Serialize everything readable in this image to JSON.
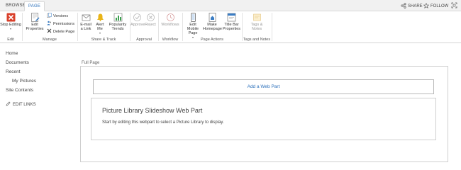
{
  "tabs": {
    "browse": "BROWSE",
    "page": "PAGE"
  },
  "top_actions": {
    "share": "SHARE",
    "follow": "FOLLOW"
  },
  "ribbon": {
    "edit_group": {
      "label": "Edit",
      "stop_editing": "Stop Editing"
    },
    "manage_group": {
      "label": "Manage",
      "edit_properties": "Edit Properties",
      "versions": "Versions",
      "permissions": "Permissions",
      "delete_page": "Delete Page"
    },
    "share_track_group": {
      "label": "Share & Track",
      "email_link": "E-mail a Link",
      "alert_me": "Alert Me",
      "popularity_trends": "Popularity Trends"
    },
    "approval_group": {
      "label": "Approval",
      "approve": "Approve",
      "reject": "Reject"
    },
    "workflow_group": {
      "label": "Workflow",
      "workflows": "Workflows"
    },
    "page_actions_group": {
      "label": "Page Actions",
      "edit_mobile_page": "Edit Mobile Page",
      "make_homepage": "Make Homepage",
      "title_bar_properties": "Title Bar Properties"
    },
    "tags_notes_group": {
      "label": "Tags and Notes",
      "tags_notes": "Tags & Notes"
    }
  },
  "leftnav": {
    "items": [
      "Home",
      "Documents",
      "Recent",
      "My Pictures",
      "Site Contents"
    ],
    "edit_links": "EDIT LINKS"
  },
  "main": {
    "zone_title": "Full Page",
    "add_web_part": "Add a Web Part",
    "webpart_title": "Picture Library Slideshow Web Part",
    "webpart_description": "Start by editing this webpart to select a Picture Library to display."
  },
  "colors": {
    "accent": "#2a6fba",
    "stop_editing_red": "#d9402b",
    "bell_yellow": "#e9b418"
  }
}
